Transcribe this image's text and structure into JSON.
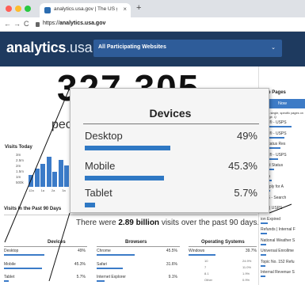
{
  "browser": {
    "tab_title": "analytics.usa.gov | The US gov",
    "tab_close": "×",
    "new_tab": "+",
    "back": "←",
    "forward": "→",
    "reload": "C",
    "url_prefix": "https://",
    "url_domain": "analytics.usa.gov",
    "colors": {
      "close": "#ff5f57",
      "minimize": "#febc2e",
      "maximize": "#28c840"
    }
  },
  "header": {
    "logo_bold": "analytics",
    "logo_light": ".usa.gov",
    "agency_select": "All Participating Websites",
    "chevron": "⌄"
  },
  "main": {
    "big_number": "327,305",
    "big_number_caption": "pec",
    "visits_today_title": "Visits Today",
    "visits_today_axis": [
      "3m",
      "2.5m",
      "2m",
      "1.5m",
      "1m",
      "500k"
    ],
    "visits_today_hours": [
      "12a",
      "1a",
      "2a",
      "3a",
      "4a"
    ],
    "visits_today_bars": [
      0.35,
      0.55,
      0.7,
      0.9,
      0.45,
      0.8,
      0.65,
      0.5
    ],
    "past_90_title": "Visits in the Past 90 Days",
    "total_prefix": "There were",
    "total_value": "2.89 billion",
    "total_suffix": "visits over the past 90 days."
  },
  "devices": {
    "title": "Devices",
    "rows": [
      {
        "label": "Desktop",
        "value": "49%",
        "fraction": 0.49
      },
      {
        "label": "Mobile",
        "value": "45.3%",
        "fraction": 0.453
      },
      {
        "label": "Tablet",
        "value": "5.7%",
        "fraction": 0.057
      }
    ]
  },
  "browsers": {
    "title": "Browsers",
    "rows": [
      {
        "label": "Chrome",
        "value": "45.5%",
        "fraction": 0.455
      },
      {
        "label": "Safari",
        "value": "31.6%",
        "fraction": 0.316
      },
      {
        "label": "Internet Explorer",
        "value": "9.1%",
        "fraction": 0.091
      }
    ]
  },
  "os": {
    "title": "Operating Systems",
    "rows": [
      {
        "label": "Windows",
        "value": "39.7%",
        "fraction": 0.397
      },
      {
        "label": "10",
        "value": "24.9%",
        "fraction": 0.249
      },
      {
        "label": "7",
        "value": "11.0%",
        "fraction": 0.11
      },
      {
        "label": "8.1",
        "value": "1.9%",
        "fraction": 0.019
      },
      {
        "label": "Other",
        "value": "0.9%",
        "fraction": 0.009
      }
    ]
  },
  "top_pages": {
    "title": "Top Pages",
    "now_button": "Now",
    "note": "Here a single, specific pages on the page. Q",
    "items": [
      {
        "label": ".com® - USPS",
        "fraction": 0.7
      },
      {
        "label": ".com® - USPS",
        "fraction": 0.55
      },
      {
        "label": "nd Status Res",
        "fraction": 0.45
      },
      {
        "label": ".com® - USPS",
        "fraction": 0.4
      },
      {
        "label": "efund Status",
        "fraction": 0.3
      },
      {
        "label": "k You",
        "fraction": 0.25
      },
      {
        "label": "® Apply for A",
        "fraction": 0.22
      },
      {
        "label": "IOBS - Search",
        "fraction": 0.2
      },
      {
        "label": "ome | USPS",
        "fraction": 0.18
      },
      {
        "label": "ion Expired",
        "fraction": 0.16
      },
      {
        "label": "Refunds | Internal F",
        "fraction": 0.14
      },
      {
        "label": "National Weather S",
        "fraction": 0.13
      },
      {
        "label": "Universal Enrollme",
        "fraction": 0.12
      },
      {
        "label": "Topic No. 152 Refu",
        "fraction": 0.11
      },
      {
        "label": "Internal Revenue S",
        "fraction": 0.1
      }
    ]
  },
  "callout": {
    "title": "Devices",
    "rows": [
      {
        "label": "Desktop",
        "value": "49%",
        "fraction": 0.49
      },
      {
        "label": "Mobile",
        "value": "45.3%",
        "fraction": 0.453
      },
      {
        "label": "Tablet",
        "value": "5.7%",
        "fraction": 0.057
      }
    ]
  }
}
